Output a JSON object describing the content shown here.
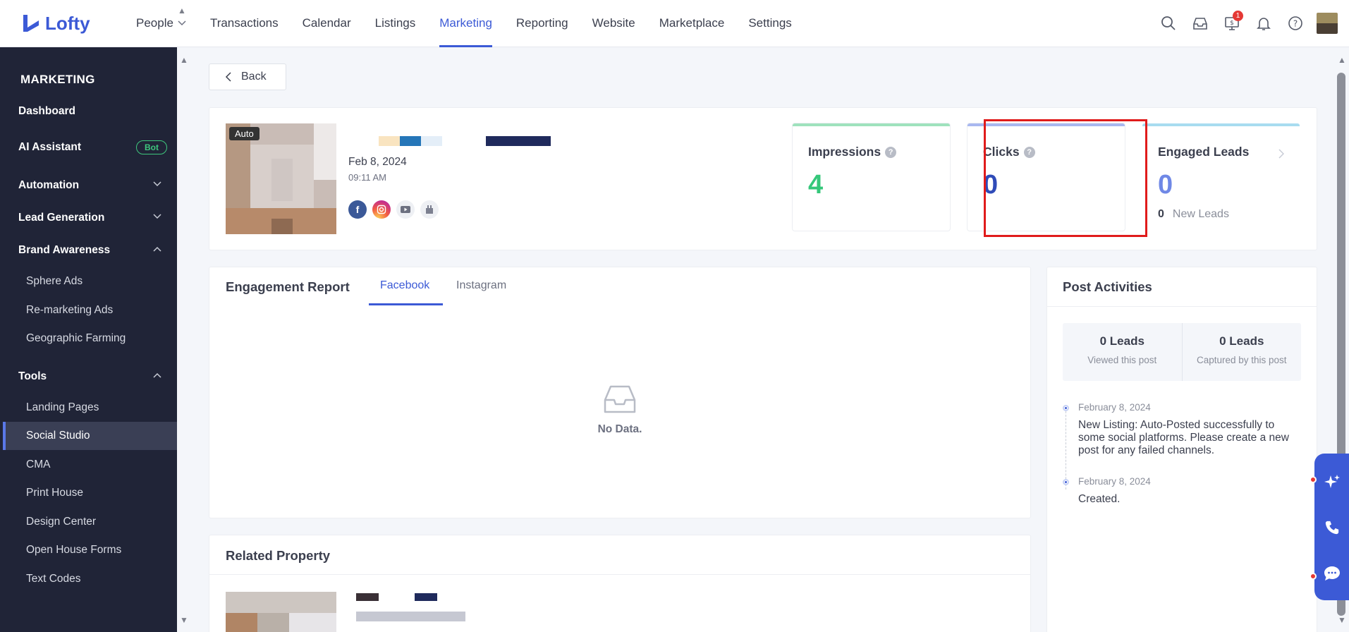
{
  "app": {
    "name": "Lofty"
  },
  "topnav": {
    "items": [
      {
        "label": "People",
        "dropdown": true
      },
      {
        "label": "Transactions"
      },
      {
        "label": "Calendar"
      },
      {
        "label": "Listings"
      },
      {
        "label": "Marketing",
        "active": true
      },
      {
        "label": "Reporting"
      },
      {
        "label": "Website"
      },
      {
        "label": "Marketplace"
      },
      {
        "label": "Settings"
      }
    ],
    "notification_count": "1"
  },
  "sidebar": {
    "title": "MARKETING",
    "dashboard": "Dashboard",
    "ai_assistant": "AI Assistant",
    "ai_badge": "Bot",
    "automation": "Automation",
    "lead_generation": "Lead Generation",
    "brand_awareness": "Brand Awareness",
    "brand_items": [
      "Sphere Ads",
      "Re-marketing Ads",
      "Geographic Farming"
    ],
    "tools": "Tools",
    "tool_items": [
      "Landing Pages",
      "Social Studio",
      "CMA",
      "Print House",
      "Design Center",
      "Open House Forms",
      "Text Codes"
    ],
    "active_item": "Social Studio"
  },
  "main": {
    "back_label": "Back",
    "post": {
      "tag": "Auto",
      "date": "Feb 8, 2024",
      "time": "09:11 AM",
      "platforms": [
        "facebook-icon",
        "instagram-icon",
        "youtube-icon",
        "google-business-icon"
      ]
    },
    "stats": {
      "impressions": {
        "label": "Impressions",
        "value": "4",
        "color": "#35c77a"
      },
      "clicks": {
        "label": "Clicks",
        "value": "0",
        "color": "#3c5ad6"
      },
      "engaged": {
        "label": "Engaged Leads",
        "value": "0",
        "new_count": "0",
        "new_label": "New Leads",
        "color": "#6f88e6"
      }
    },
    "engagement": {
      "title": "Engagement Report",
      "tabs": [
        "Facebook",
        "Instagram"
      ],
      "active_tab": "Facebook",
      "empty_text": "No Data."
    },
    "related": {
      "title": "Related Property"
    },
    "activities": {
      "title": "Post Activities",
      "viewed": {
        "value": "0 Leads",
        "desc": "Viewed this post"
      },
      "captured": {
        "value": "0 Leads",
        "desc": "Captured by this post"
      },
      "timeline": [
        {
          "date": "February 8, 2024",
          "text": "New Listing: Auto-Posted successfully to some social platforms. Please create a new post for any failed channels."
        },
        {
          "date": "February 8, 2024",
          "text": "Created."
        }
      ]
    }
  },
  "colors": {
    "accent": "#3c5ad6",
    "sidebar_bg": "#202437",
    "highlight": "#e01b1b"
  }
}
